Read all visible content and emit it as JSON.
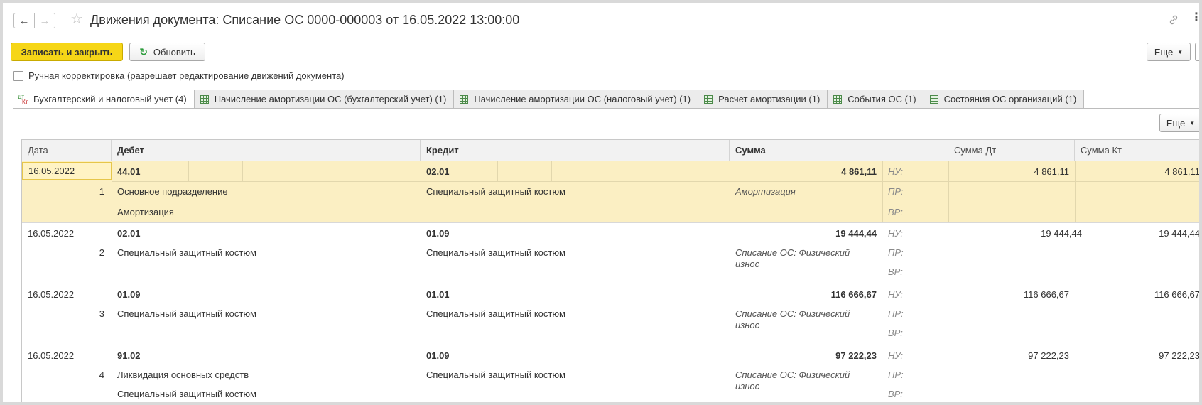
{
  "window": {
    "title": "Движения документа: Списание ОС 0000-000003 от 16.05.2022 13:00:00",
    "back_icon": "arrow-left-icon",
    "forward_icon": "arrow-right-icon",
    "favorite_icon": "star-icon",
    "link_icon": "link-icon",
    "menu_icon": "more-vertical-icon"
  },
  "toolbar": {
    "save_close_label": "Записать и закрыть",
    "refresh_label": "Обновить",
    "more_label": "Еще",
    "accent_color": "#f6d617"
  },
  "manual_edit": {
    "label": "Ручная корректировка (разрешает редактирование движений документа)",
    "checked": false
  },
  "tabs": [
    {
      "label": "Бухгалтерский и налоговый учет (4)",
      "icon": "dt-kt-icon",
      "active": true
    },
    {
      "label": "Начисление амортизации ОС (бухгалтерский учет) (1)",
      "icon": "register-grid-icon",
      "active": false
    },
    {
      "label": "Начисление амортизации ОС (налоговый учет) (1)",
      "icon": "register-grid-icon",
      "active": false
    },
    {
      "label": "Расчет амортизации (1)",
      "icon": "register-grid-icon",
      "active": false
    },
    {
      "label": "События ОС (1)",
      "icon": "register-grid-icon",
      "active": false
    },
    {
      "label": "Состояния ОС организаций (1)",
      "icon": "register-grid-icon",
      "active": false
    }
  ],
  "table": {
    "more_label": "Еще",
    "columns": {
      "date": "Дата",
      "debit": "Дебет",
      "credit": "Кредит",
      "amount": "Сумма",
      "blank": "",
      "amount_dt": "Сумма Дт",
      "amount_kt": "Сумма Кт"
    },
    "labels": {
      "nu": "НУ:",
      "pr": "ПР:",
      "vr": "ВР:"
    },
    "rows": [
      {
        "date": "16.05.2022",
        "num": "1",
        "debit": "44.01",
        "debit_sub1": "Основное подразделение",
        "debit_sub2": "Амортизация",
        "credit": "02.01",
        "credit_sub1": "Специальный защитный костюм",
        "amount": "4 861,11",
        "content": "Амортизация",
        "amount_dt": "4 861,11",
        "amount_kt": "4 861,11",
        "selected": true
      },
      {
        "date": "16.05.2022",
        "num": "2",
        "debit": "02.01",
        "debit_sub1": "Специальный защитный костюм",
        "debit_sub2": "",
        "credit": "01.09",
        "credit_sub1": "Специальный защитный костюм",
        "amount": "19 444,44",
        "content": "Списание ОС: Физический износ",
        "amount_dt": "19 444,44",
        "amount_kt": "19 444,44",
        "selected": false
      },
      {
        "date": "16.05.2022",
        "num": "3",
        "debit": "01.09",
        "debit_sub1": "Специальный защитный костюм",
        "debit_sub2": "",
        "credit": "01.01",
        "credit_sub1": "Специальный защитный костюм",
        "amount": "116 666,67",
        "content": "Списание ОС: Физический износ",
        "amount_dt": "116 666,67",
        "amount_kt": "116 666,67",
        "selected": false
      },
      {
        "date": "16.05.2022",
        "num": "4",
        "debit": "91.02",
        "debit_sub1": "Ликвидация основных средств",
        "debit_sub2": "Специальный защитный костюм",
        "credit": "01.09",
        "credit_sub1": "Специальный защитный костюм",
        "amount": "97 222,23",
        "content": "Списание ОС: Физический износ",
        "amount_dt": "97 222,23",
        "amount_kt": "97 222,23",
        "selected": false
      }
    ]
  }
}
